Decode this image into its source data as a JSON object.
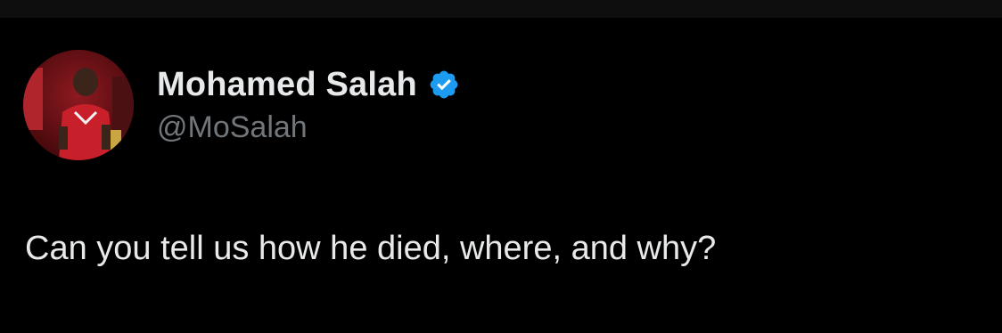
{
  "author": {
    "display_name": "Mohamed Salah",
    "handle": "@MoSalah",
    "verified": true
  },
  "tweet": {
    "text": "Can you tell us how he died, where, and why?"
  },
  "colors": {
    "background": "#000000",
    "text_primary": "#e7e9ea",
    "text_secondary": "#71767b",
    "verified_badge": "#1d9bf0"
  },
  "icons": {
    "verified": "verified-badge-icon",
    "avatar": "profile-photo"
  }
}
